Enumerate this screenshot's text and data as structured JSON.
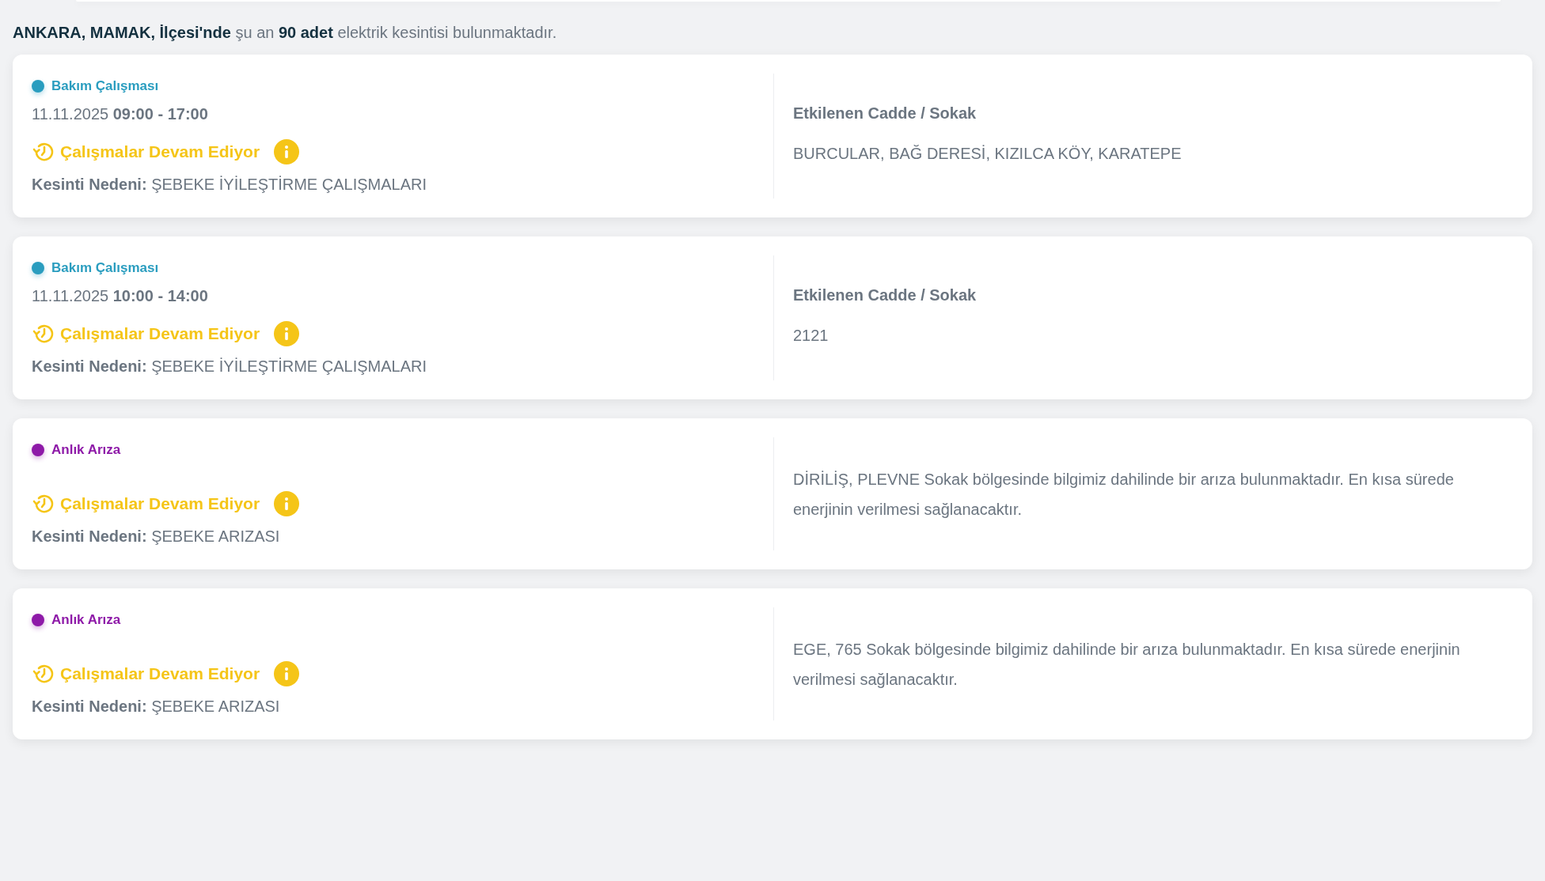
{
  "summary": "**ANKARA, MAMAK, İlçesi'nde** şu an **90 adet** elektrik kesintisi bulunmaktadır.",
  "outages": [
    {
      "category": "Bakım Çalışması",
      "color": "#2a9dbf",
      "date": "11.11.2025",
      "time": "09:00 - 17:00",
      "status": "Çalışmalar Devam Ediyor",
      "reason_label": "Kesinti Nedeni:",
      "reason": "ŞEBEKE İYİLEŞTİRME ÇALIŞMALARI",
      "detail": {
        "kind": "streets",
        "heading": "Etkilenen Cadde / Sokak",
        "text": "BURCULAR, BAĞ DERESİ, KIZILCA KÖY, KARATEPE"
      }
    },
    {
      "category": "Bakım Çalışması",
      "color": "#2a9dbf",
      "date": "11.11.2025",
      "time": "10:00 - 14:00",
      "status": "Çalışmalar Devam Ediyor",
      "reason_label": "Kesinti Nedeni:",
      "reason": "ŞEBEKE İYİLEŞTİRME ÇALIŞMALARI",
      "detail": {
        "kind": "streets",
        "heading": "Etkilenen Cadde / Sokak",
        "text": "2121"
      }
    },
    {
      "category": "Anlık Arıza",
      "color": "#8e1aa8",
      "status": "Çalışmalar Devam Ediyor",
      "reason_label": "Kesinti Nedeni:",
      "reason": "ŞEBEKE ARIZASI",
      "detail": {
        "kind": "message",
        "text": "DİRİLİŞ, PLEVNE Sokak bölgesinde bilgimiz dahilinde bir arıza bulunmaktadır. En kısa sürede enerjinin verilmesi sağlanacaktır."
      }
    },
    {
      "category": "Anlık Arıza",
      "color": "#8e1aa8",
      "status": "Çalışmalar Devam Ediyor",
      "reason_label": "Kesinti Nedeni:",
      "reason": "ŞEBEKE ARIZASI",
      "detail": {
        "kind": "message",
        "text": "EGE, 765 Sokak bölgesinde bilgimiz dahilinde bir arıza bulunmaktadır. En kısa sürede enerjinin verilmesi sağlanacaktır."
      }
    }
  ]
}
